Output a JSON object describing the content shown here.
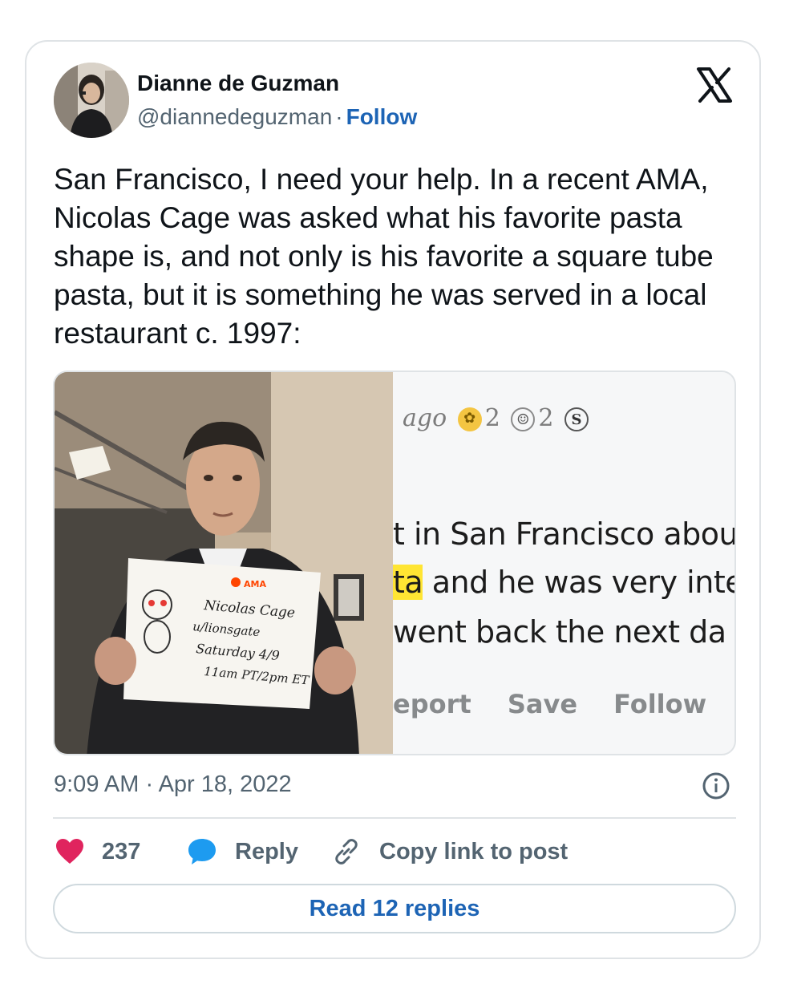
{
  "author": {
    "name": "Dianne de Guzman",
    "handle": "@diannedeguzman",
    "separator": "·",
    "follow_label": "Follow"
  },
  "tweet": {
    "text": "San Francisco, I need your help. In a recent AMA, Nicolas Cage was asked what his favorite pasta shape is, and not only is his favorite a square tube pasta, but it is something he was served in a local restaurant c. 1997:",
    "timestamp": "9:09 AM · Apr 18, 2022"
  },
  "media": {
    "sign": {
      "badge": "AMA",
      "line1": "Nicolas Cage",
      "line2": "u/lionsgate",
      "line3": "Saturday 4/9",
      "line4": "11am PT/2pm ET"
    },
    "screenshot": {
      "ago": "ago",
      "award1_count": "2",
      "award2_count": "2",
      "award3_glyph": "S",
      "line1": "t in San Francisco abou",
      "line2_highlight": "ta",
      "line2_rest": " and he was very inte",
      "line3": " went back the next da",
      "action_report": "eport",
      "action_save": "Save",
      "action_follow": "Follow"
    }
  },
  "actions": {
    "like_count": "237",
    "reply_label": "Reply",
    "copy_link_label": "Copy link to post",
    "read_replies_label": "Read 12 replies"
  },
  "icons": {
    "brand": "x-logo-icon",
    "like": "heart-icon",
    "reply": "speech-bubble-icon",
    "copy": "link-icon",
    "info": "info-icon"
  },
  "colors": {
    "like": "#e0245e",
    "link": "#1d64b5",
    "reply_icon": "#1d9bf0",
    "muted": "#536471"
  }
}
